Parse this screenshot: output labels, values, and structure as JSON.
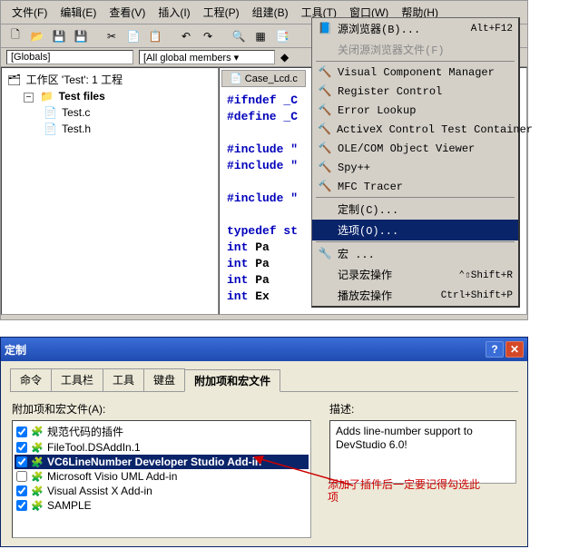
{
  "menubar": [
    "文件(F)",
    "编辑(E)",
    "查看(V)",
    "插入(I)",
    "工程(P)",
    "组建(B)",
    "工具(T)",
    "窗口(W)",
    "帮助(H)"
  ],
  "combos": {
    "globals": "[Globals]",
    "members": "[All global members ▾"
  },
  "tree": {
    "root": "工作区 'Test': 1 工程",
    "proj": "Test files",
    "file1": "Test.c",
    "file2": "Test.h"
  },
  "code_tab": "Case_Lcd.c",
  "code": [
    {
      "t": "#ifndef  _C",
      "kw": 1
    },
    {
      "t": "#define  _C",
      "kw": 1
    },
    {
      "t": ""
    },
    {
      "t": "#include \"",
      "kw": 1
    },
    {
      "t": "#include \"",
      "kw": 1
    },
    {
      "t": ""
    },
    {
      "t": "#include \"",
      "kw": 1
    },
    {
      "t": ""
    },
    {
      "t": "typedef st",
      "kw": 1
    },
    {
      "t": "    int Pa",
      "kw": 2
    },
    {
      "t": "    int Pa",
      "kw": 2
    },
    {
      "t": "    int Pa",
      "kw": 2
    },
    {
      "t": "    int Ex",
      "kw": 2
    }
  ],
  "dropdown": [
    {
      "type": "item",
      "label": "源浏览器(B)...",
      "shortcut": "Alt+F12",
      "icon": "📘"
    },
    {
      "type": "item",
      "label": "关闭源浏览器文件(F)",
      "disabled": true
    },
    {
      "type": "sep"
    },
    {
      "type": "item",
      "label": "Visual Component Manager",
      "icon": "🔨"
    },
    {
      "type": "item",
      "label": "Register Control",
      "icon": "🔨"
    },
    {
      "type": "item",
      "label": "Error Lookup",
      "icon": "🔨"
    },
    {
      "type": "item",
      "label": "ActiveX Control Test Container",
      "icon": "🔨"
    },
    {
      "type": "item",
      "label": "OLE/COM Object Viewer",
      "icon": "🔨"
    },
    {
      "type": "item",
      "label": "Spy++",
      "icon": "🔨"
    },
    {
      "type": "item",
      "label": "MFC Tracer",
      "icon": "🔨"
    },
    {
      "type": "sep"
    },
    {
      "type": "item",
      "label": "定制(C)..."
    },
    {
      "type": "item",
      "label": "选项(O)...",
      "selected": true
    },
    {
      "type": "sep"
    },
    {
      "type": "item",
      "label": "宏 ...",
      "icon": "🔧"
    },
    {
      "type": "item",
      "label": "记录宏操作",
      "shortcut": "⌃⇧Shift+R"
    },
    {
      "type": "item",
      "label": "播放宏操作",
      "shortcut": "Ctrl+Shift+P"
    }
  ],
  "dialog": {
    "title": "定制",
    "tabs": [
      "命令",
      "工具栏",
      "工具",
      "键盘",
      "附加项和宏文件"
    ],
    "active_tab": 4,
    "list_label": "附加项和宏文件(A):",
    "items": [
      {
        "label": "规范代码的插件",
        "checked": true
      },
      {
        "label": "FileTool.DSAddIn.1",
        "checked": true
      },
      {
        "label": "VC6LineNumber Developer Studio Add-in",
        "checked": true,
        "selected": true
      },
      {
        "label": "Microsoft Visio UML Add-in",
        "checked": false
      },
      {
        "label": "Visual Assist X Add-in",
        "checked": true
      },
      {
        "label": "SAMPLE",
        "checked": true
      }
    ],
    "desc_label": "描述:",
    "desc": "Adds line-number support to DevStudio 6.0!",
    "annotation": "添加了插件后一定要记得勾选此项"
  }
}
